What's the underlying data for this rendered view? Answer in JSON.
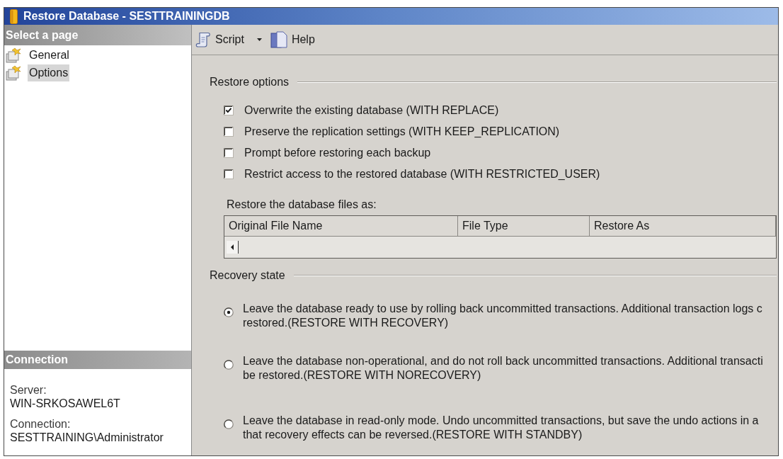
{
  "window": {
    "title": "Restore Database - SESTTRAININGDB"
  },
  "sidebar": {
    "header": "Select a page",
    "items": [
      {
        "label": "General",
        "selected": false
      },
      {
        "label": "Options",
        "selected": true
      }
    ]
  },
  "connection": {
    "header": "Connection",
    "fields": [
      {
        "label": "Server:",
        "value": "WIN-SRKOSAWEL6T"
      },
      {
        "label": "Connection:",
        "value": "SESTTRAINING\\Administrator"
      }
    ]
  },
  "toolbar": {
    "buttons": [
      {
        "label": "Script",
        "kind": "script",
        "dropdown": true
      },
      {
        "label": "Help",
        "kind": "help",
        "dropdown": false
      }
    ]
  },
  "restore_options": {
    "title": "Restore options",
    "checkboxes": [
      {
        "label": "Overwrite the existing database (WITH REPLACE)",
        "checked": true
      },
      {
        "label": "Preserve the replication settings (WITH KEEP_REPLICATION)",
        "checked": false
      },
      {
        "label": "Prompt before restoring each backup",
        "checked": false
      },
      {
        "label": "Restrict access to the restored database (WITH RESTRICTED_USER)",
        "checked": false
      }
    ],
    "files_label": "Restore the database files as:",
    "files_table": {
      "columns": [
        "Original File Name",
        "File Type",
        "Restore As"
      ]
    }
  },
  "recovery_state": {
    "title": "Recovery state",
    "options": [
      {
        "lines": [
          "Leave the database ready to use by rolling back uncommitted transactions. Additional transaction logs c",
          "restored.(RESTORE WITH RECOVERY)"
        ],
        "selected": true
      },
      {
        "lines": [
          "Leave the database non-operational, and do not roll back uncommitted transactions. Additional transacti",
          "be restored.(RESTORE WITH NORECOVERY)"
        ],
        "selected": false
      },
      {
        "lines": [
          "Leave the database in read-only mode. Undo uncommitted transactions, but save the undo actions in a",
          "that recovery effects can be reversed.(RESTORE WITH STANDBY)"
        ],
        "selected": false
      }
    ]
  }
}
